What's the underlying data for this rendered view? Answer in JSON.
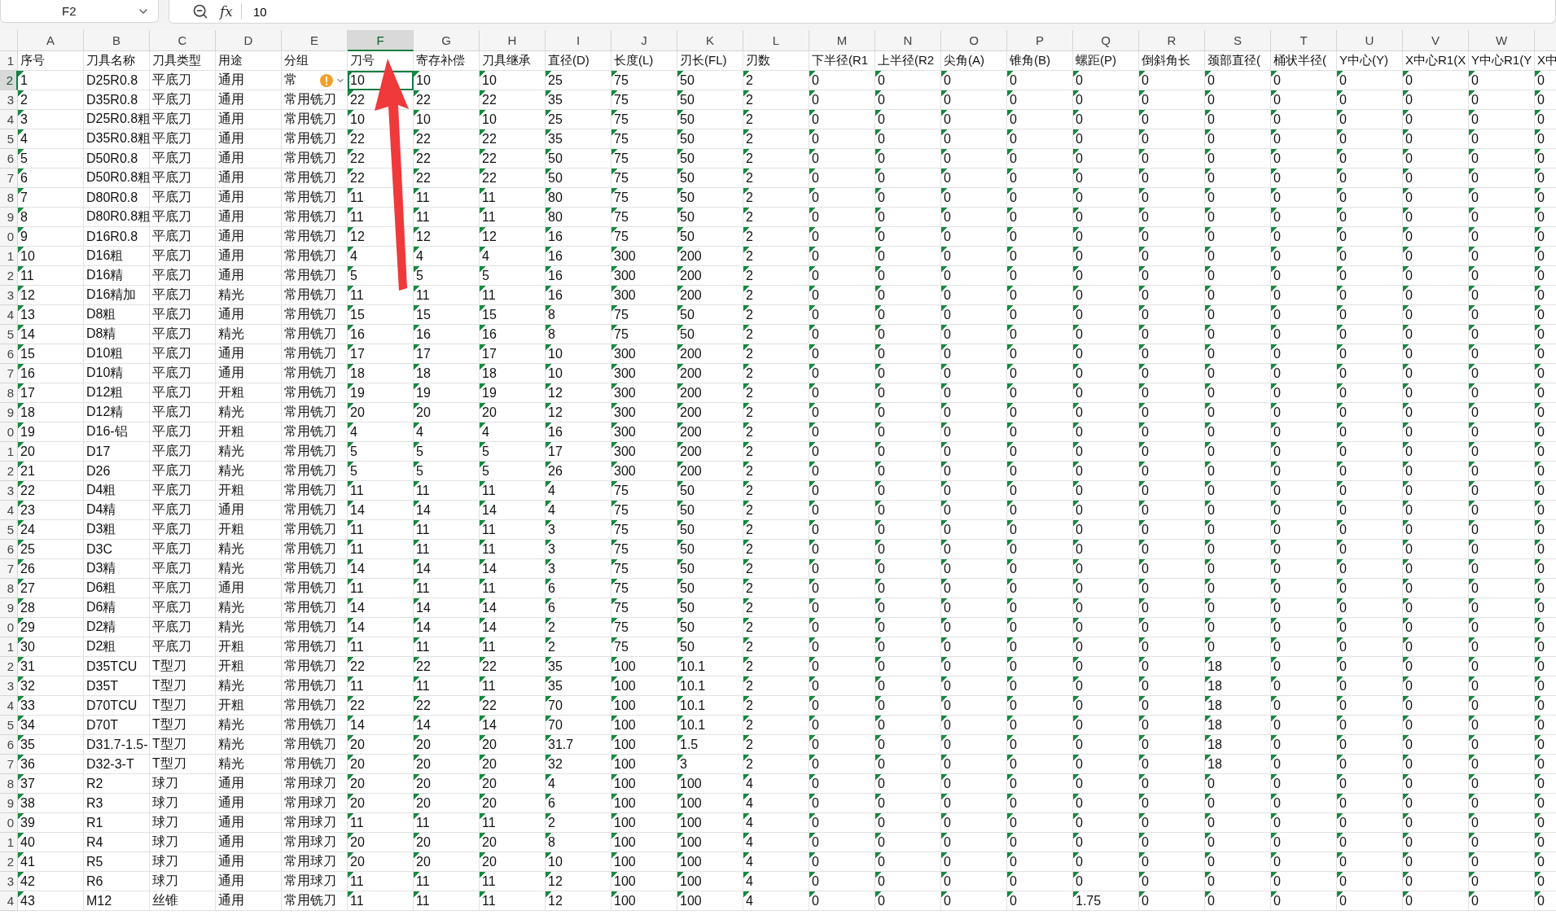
{
  "formula_bar": {
    "name_box": "F2",
    "function_label": "fx",
    "value": "10"
  },
  "columns": [
    {
      "letter": "A",
      "selected": false,
      "flagged": true
    },
    {
      "letter": "B",
      "selected": false,
      "flagged": false
    },
    {
      "letter": "C",
      "selected": false,
      "flagged": false
    },
    {
      "letter": "D",
      "selected": false,
      "flagged": false
    },
    {
      "letter": "E",
      "selected": false,
      "flagged": false
    },
    {
      "letter": "F",
      "selected": true,
      "flagged": true
    },
    {
      "letter": "G",
      "selected": false,
      "flagged": true
    },
    {
      "letter": "H",
      "selected": false,
      "flagged": true
    },
    {
      "letter": "I",
      "selected": false,
      "flagged": true
    },
    {
      "letter": "J",
      "selected": false,
      "flagged": true
    },
    {
      "letter": "K",
      "selected": false,
      "flagged": true
    },
    {
      "letter": "L",
      "selected": false,
      "flagged": true
    },
    {
      "letter": "M",
      "selected": false,
      "flagged": true
    },
    {
      "letter": "N",
      "selected": false,
      "flagged": true
    },
    {
      "letter": "O",
      "selected": false,
      "flagged": true
    },
    {
      "letter": "P",
      "selected": false,
      "flagged": true
    },
    {
      "letter": "Q",
      "selected": false,
      "flagged": true
    },
    {
      "letter": "R",
      "selected": false,
      "flagged": true
    },
    {
      "letter": "S",
      "selected": false,
      "flagged": true
    },
    {
      "letter": "T",
      "selected": false,
      "flagged": true
    },
    {
      "letter": "U",
      "selected": false,
      "flagged": true
    },
    {
      "letter": "V",
      "selected": false,
      "flagged": true
    },
    {
      "letter": "W",
      "selected": false,
      "flagged": true
    },
    {
      "selected": false,
      "flagged": true
    }
  ],
  "rows": [
    {
      "label": "1",
      "kind": "header",
      "selected": false,
      "cells": [
        "序号",
        "刀具名称",
        "刀具类型",
        "用途",
        "分组",
        "刀号",
        "寄存补偿",
        "刀具继承",
        "直径(D)",
        "长度(L)",
        "刃长(FL)",
        "刃数",
        "下半径(R1",
        "上半径(R2",
        "尖角(A)",
        "锥角(B)",
        "螺距(P)",
        "倒斜角长",
        "颈部直径(",
        "桶状半径(",
        "Y中心(Y)",
        "X中心R1(X",
        "Y中心R1(Y",
        "X中"
      ]
    },
    {
      "label": "2",
      "kind": "data",
      "selected": true,
      "warning": true,
      "cells": [
        "1",
        "D25R0.8",
        "平底刀",
        "通用",
        "常",
        "10",
        "10",
        "10",
        "25",
        "75",
        "50",
        "2",
        "0",
        "0",
        "0",
        "0",
        "0",
        "0",
        "0",
        "0",
        "0",
        "0",
        "0",
        "0"
      ]
    },
    {
      "label": "3",
      "kind": "data",
      "selected": false,
      "cells": [
        "2",
        "D35R0.8",
        "平底刀",
        "通用",
        "常用铣刀",
        "22",
        "22",
        "22",
        "35",
        "75",
        "50",
        "2",
        "0",
        "0",
        "0",
        "0",
        "0",
        "0",
        "0",
        "0",
        "0",
        "0",
        "0",
        "0"
      ]
    },
    {
      "label": "4",
      "kind": "data",
      "selected": false,
      "cells": [
        "3",
        "D25R0.8粗",
        "平底刀",
        "通用",
        "常用铣刀",
        "10",
        "10",
        "10",
        "25",
        "75",
        "50",
        "2",
        "0",
        "0",
        "0",
        "0",
        "0",
        "0",
        "0",
        "0",
        "0",
        "0",
        "0",
        "0"
      ]
    },
    {
      "label": "5",
      "kind": "data",
      "selected": false,
      "cells": [
        "4",
        "D35R0.8粗",
        "平底刀",
        "通用",
        "常用铣刀",
        "22",
        "22",
        "22",
        "35",
        "75",
        "50",
        "2",
        "0",
        "0",
        "0",
        "0",
        "0",
        "0",
        "0",
        "0",
        "0",
        "0",
        "0",
        "0"
      ]
    },
    {
      "label": "6",
      "kind": "data",
      "selected": false,
      "cells": [
        "5",
        "D50R0.8",
        "平底刀",
        "通用",
        "常用铣刀",
        "22",
        "22",
        "22",
        "50",
        "75",
        "50",
        "2",
        "0",
        "0",
        "0",
        "0",
        "0",
        "0",
        "0",
        "0",
        "0",
        "0",
        "0",
        "0"
      ]
    },
    {
      "label": "7",
      "kind": "data",
      "selected": false,
      "cells": [
        "6",
        "D50R0.8粗",
        "平底刀",
        "通用",
        "常用铣刀",
        "22",
        "22",
        "22",
        "50",
        "75",
        "50",
        "2",
        "0",
        "0",
        "0",
        "0",
        "0",
        "0",
        "0",
        "0",
        "0",
        "0",
        "0",
        "0"
      ]
    },
    {
      "label": "8",
      "kind": "data",
      "selected": false,
      "cells": [
        "7",
        "D80R0.8",
        "平底刀",
        "通用",
        "常用铣刀",
        "11",
        "11",
        "11",
        "80",
        "75",
        "50",
        "2",
        "0",
        "0",
        "0",
        "0",
        "0",
        "0",
        "0",
        "0",
        "0",
        "0",
        "0",
        "0"
      ]
    },
    {
      "label": "9",
      "kind": "data",
      "selected": false,
      "cells": [
        "8",
        "D80R0.8粗",
        "平底刀",
        "通用",
        "常用铣刀",
        "11",
        "11",
        "11",
        "80",
        "75",
        "50",
        "2",
        "0",
        "0",
        "0",
        "0",
        "0",
        "0",
        "0",
        "0",
        "0",
        "0",
        "0",
        "0"
      ]
    },
    {
      "label": "0",
      "kind": "data",
      "selected": false,
      "cells": [
        "9",
        "D16R0.8",
        "平底刀",
        "通用",
        "常用铣刀",
        "12",
        "12",
        "12",
        "16",
        "75",
        "50",
        "2",
        "0",
        "0",
        "0",
        "0",
        "0",
        "0",
        "0",
        "0",
        "0",
        "0",
        "0",
        "0"
      ]
    },
    {
      "label": "1",
      "kind": "data",
      "selected": false,
      "cells": [
        "10",
        "D16粗",
        "平底刀",
        "通用",
        "常用铣刀",
        "4",
        "4",
        "4",
        "16",
        "300",
        "200",
        "2",
        "0",
        "0",
        "0",
        "0",
        "0",
        "0",
        "0",
        "0",
        "0",
        "0",
        "0",
        "0"
      ]
    },
    {
      "label": "2",
      "kind": "data",
      "selected": false,
      "cells": [
        "11",
        "D16精",
        "平底刀",
        "通用",
        "常用铣刀",
        "5",
        "5",
        "5",
        "16",
        "300",
        "200",
        "2",
        "0",
        "0",
        "0",
        "0",
        "0",
        "0",
        "0",
        "0",
        "0",
        "0",
        "0",
        "0"
      ]
    },
    {
      "label": "3",
      "kind": "data",
      "selected": false,
      "cells": [
        "12",
        "D16精加",
        "平底刀",
        "精光",
        "常用铣刀",
        "11",
        "11",
        "11",
        "16",
        "300",
        "200",
        "2",
        "0",
        "0",
        "0",
        "0",
        "0",
        "0",
        "0",
        "0",
        "0",
        "0",
        "0",
        "0"
      ]
    },
    {
      "label": "4",
      "kind": "data",
      "selected": false,
      "cells": [
        "13",
        "D8粗",
        "平底刀",
        "通用",
        "常用铣刀",
        "15",
        "15",
        "15",
        "8",
        "75",
        "50",
        "2",
        "0",
        "0",
        "0",
        "0",
        "0",
        "0",
        "0",
        "0",
        "0",
        "0",
        "0",
        "0"
      ]
    },
    {
      "label": "5",
      "kind": "data",
      "selected": false,
      "cells": [
        "14",
        "D8精",
        "平底刀",
        "精光",
        "常用铣刀",
        "16",
        "16",
        "16",
        "8",
        "75",
        "50",
        "2",
        "0",
        "0",
        "0",
        "0",
        "0",
        "0",
        "0",
        "0",
        "0",
        "0",
        "0",
        "0"
      ]
    },
    {
      "label": "6",
      "kind": "data",
      "selected": false,
      "cells": [
        "15",
        "D10粗",
        "平底刀",
        "通用",
        "常用铣刀",
        "17",
        "17",
        "17",
        "10",
        "300",
        "200",
        "2",
        "0",
        "0",
        "0",
        "0",
        "0",
        "0",
        "0",
        "0",
        "0",
        "0",
        "0",
        "0"
      ]
    },
    {
      "label": "7",
      "kind": "data",
      "selected": false,
      "cells": [
        "16",
        "D10精",
        "平底刀",
        "通用",
        "常用铣刀",
        "18",
        "18",
        "18",
        "10",
        "300",
        "200",
        "2",
        "0",
        "0",
        "0",
        "0",
        "0",
        "0",
        "0",
        "0",
        "0",
        "0",
        "0",
        "0"
      ]
    },
    {
      "label": "8",
      "kind": "data",
      "selected": false,
      "cells": [
        "17",
        "D12粗",
        "平底刀",
        "开粗",
        "常用铣刀",
        "19",
        "19",
        "19",
        "12",
        "300",
        "200",
        "2",
        "0",
        "0",
        "0",
        "0",
        "0",
        "0",
        "0",
        "0",
        "0",
        "0",
        "0",
        "0"
      ]
    },
    {
      "label": "9",
      "kind": "data",
      "selected": false,
      "cells": [
        "18",
        "D12精",
        "平底刀",
        "精光",
        "常用铣刀",
        "20",
        "20",
        "20",
        "12",
        "300",
        "200",
        "2",
        "0",
        "0",
        "0",
        "0",
        "0",
        "0",
        "0",
        "0",
        "0",
        "0",
        "0",
        "0"
      ]
    },
    {
      "label": "0",
      "kind": "data",
      "selected": false,
      "cells": [
        "19",
        "D16-铝",
        "平底刀",
        "开粗",
        "常用铣刀",
        "4",
        "4",
        "4",
        "16",
        "300",
        "200",
        "2",
        "0",
        "0",
        "0",
        "0",
        "0",
        "0",
        "0",
        "0",
        "0",
        "0",
        "0",
        "0"
      ]
    },
    {
      "label": "1",
      "kind": "data",
      "selected": false,
      "cells": [
        "20",
        "D17",
        "平底刀",
        "精光",
        "常用铣刀",
        "5",
        "5",
        "5",
        "17",
        "300",
        "200",
        "2",
        "0",
        "0",
        "0",
        "0",
        "0",
        "0",
        "0",
        "0",
        "0",
        "0",
        "0",
        "0"
      ]
    },
    {
      "label": "2",
      "kind": "data",
      "selected": false,
      "cells": [
        "21",
        "D26",
        "平底刀",
        "精光",
        "常用铣刀",
        "5",
        "5",
        "5",
        "26",
        "300",
        "200",
        "2",
        "0",
        "0",
        "0",
        "0",
        "0",
        "0",
        "0",
        "0",
        "0",
        "0",
        "0",
        "0"
      ]
    },
    {
      "label": "3",
      "kind": "data",
      "selected": false,
      "cells": [
        "22",
        "D4粗",
        "平底刀",
        "开粗",
        "常用铣刀",
        "11",
        "11",
        "11",
        "4",
        "75",
        "50",
        "2",
        "0",
        "0",
        "0",
        "0",
        "0",
        "0",
        "0",
        "0",
        "0",
        "0",
        "0",
        "0"
      ]
    },
    {
      "label": "4",
      "kind": "data",
      "selected": false,
      "cells": [
        "23",
        "D4精",
        "平底刀",
        "通用",
        "常用铣刀",
        "14",
        "14",
        "14",
        "4",
        "75",
        "50",
        "2",
        "0",
        "0",
        "0",
        "0",
        "0",
        "0",
        "0",
        "0",
        "0",
        "0",
        "0",
        "0"
      ]
    },
    {
      "label": "5",
      "kind": "data",
      "selected": false,
      "cells": [
        "24",
        "D3粗",
        "平底刀",
        "开粗",
        "常用铣刀",
        "11",
        "11",
        "11",
        "3",
        "75",
        "50",
        "2",
        "0",
        "0",
        "0",
        "0",
        "0",
        "0",
        "0",
        "0",
        "0",
        "0",
        "0",
        "0"
      ]
    },
    {
      "label": "6",
      "kind": "data",
      "selected": false,
      "cells": [
        "25",
        "D3C",
        "平底刀",
        "精光",
        "常用铣刀",
        "11",
        "11",
        "11",
        "3",
        "75",
        "50",
        "2",
        "0",
        "0",
        "0",
        "0",
        "0",
        "0",
        "0",
        "0",
        "0",
        "0",
        "0",
        "0"
      ]
    },
    {
      "label": "7",
      "kind": "data",
      "selected": false,
      "cells": [
        "26",
        "D3精",
        "平底刀",
        "精光",
        "常用铣刀",
        "14",
        "14",
        "14",
        "3",
        "75",
        "50",
        "2",
        "0",
        "0",
        "0",
        "0",
        "0",
        "0",
        "0",
        "0",
        "0",
        "0",
        "0",
        "0"
      ]
    },
    {
      "label": "8",
      "kind": "data",
      "selected": false,
      "cells": [
        "27",
        "D6粗",
        "平底刀",
        "通用",
        "常用铣刀",
        "11",
        "11",
        "11",
        "6",
        "75",
        "50",
        "2",
        "0",
        "0",
        "0",
        "0",
        "0",
        "0",
        "0",
        "0",
        "0",
        "0",
        "0",
        "0"
      ]
    },
    {
      "label": "9",
      "kind": "data",
      "selected": false,
      "cells": [
        "28",
        "D6精",
        "平底刀",
        "精光",
        "常用铣刀",
        "14",
        "14",
        "14",
        "6",
        "75",
        "50",
        "2",
        "0",
        "0",
        "0",
        "0",
        "0",
        "0",
        "0",
        "0",
        "0",
        "0",
        "0",
        "0"
      ]
    },
    {
      "label": "0",
      "kind": "data",
      "selected": false,
      "cells": [
        "29",
        "D2精",
        "平底刀",
        "精光",
        "常用铣刀",
        "14",
        "14",
        "14",
        "2",
        "75",
        "50",
        "2",
        "0",
        "0",
        "0",
        "0",
        "0",
        "0",
        "0",
        "0",
        "0",
        "0",
        "0",
        "0"
      ]
    },
    {
      "label": "1",
      "kind": "data",
      "selected": false,
      "cells": [
        "30",
        "D2粗",
        "平底刀",
        "开粗",
        "常用铣刀",
        "11",
        "11",
        "11",
        "2",
        "75",
        "50",
        "2",
        "0",
        "0",
        "0",
        "0",
        "0",
        "0",
        "0",
        "0",
        "0",
        "0",
        "0",
        "0"
      ]
    },
    {
      "label": "2",
      "kind": "data",
      "selected": false,
      "cells": [
        "31",
        "D35TCU",
        "T型刀",
        "开粗",
        "常用铣刀",
        "22",
        "22",
        "22",
        "35",
        "100",
        "10.1",
        "2",
        "0",
        "0",
        "0",
        "0",
        "0",
        "0",
        "18",
        "0",
        "0",
        "0",
        "0",
        "0"
      ]
    },
    {
      "label": "3",
      "kind": "data",
      "selected": false,
      "cells": [
        "32",
        "D35T",
        "T型刀",
        "精光",
        "常用铣刀",
        "11",
        "11",
        "11",
        "35",
        "100",
        "10.1",
        "2",
        "0",
        "0",
        "0",
        "0",
        "0",
        "0",
        "18",
        "0",
        "0",
        "0",
        "0",
        "0"
      ]
    },
    {
      "label": "4",
      "kind": "data",
      "selected": false,
      "cells": [
        "33",
        "D70TCU",
        "T型刀",
        "开粗",
        "常用铣刀",
        "22",
        "22",
        "22",
        "70",
        "100",
        "10.1",
        "2",
        "0",
        "0",
        "0",
        "0",
        "0",
        "0",
        "18",
        "0",
        "0",
        "0",
        "0",
        "0"
      ]
    },
    {
      "label": "5",
      "kind": "data",
      "selected": false,
      "cells": [
        "34",
        "D70T",
        "T型刀",
        "精光",
        "常用铣刀",
        "14",
        "14",
        "14",
        "70",
        "100",
        "10.1",
        "2",
        "0",
        "0",
        "0",
        "0",
        "0",
        "0",
        "18",
        "0",
        "0",
        "0",
        "0",
        "0"
      ]
    },
    {
      "label": "6",
      "kind": "data",
      "selected": false,
      "cells": [
        "35",
        "D31.7-1.5-",
        "T型刀",
        "精光",
        "常用铣刀",
        "20",
        "20",
        "20",
        "31.7",
        "100",
        "1.5",
        "2",
        "0",
        "0",
        "0",
        "0",
        "0",
        "0",
        "18",
        "0",
        "0",
        "0",
        "0",
        "0"
      ]
    },
    {
      "label": "7",
      "kind": "data",
      "selected": false,
      "cells": [
        "36",
        "D32-3-T",
        "T型刀",
        "精光",
        "常用铣刀",
        "20",
        "20",
        "20",
        "32",
        "100",
        "3",
        "2",
        "0",
        "0",
        "0",
        "0",
        "0",
        "0",
        "18",
        "0",
        "0",
        "0",
        "0",
        "0"
      ]
    },
    {
      "label": "8",
      "kind": "data",
      "selected": false,
      "cells": [
        "37",
        "R2",
        "球刀",
        "通用",
        "常用球刀",
        "20",
        "20",
        "20",
        "4",
        "100",
        "100",
        "4",
        "0",
        "0",
        "0",
        "0",
        "0",
        "0",
        "0",
        "0",
        "0",
        "0",
        "0",
        "0"
      ]
    },
    {
      "label": "9",
      "kind": "data",
      "selected": false,
      "cells": [
        "38",
        "R3",
        "球刀",
        "通用",
        "常用球刀",
        "20",
        "20",
        "20",
        "6",
        "100",
        "100",
        "4",
        "0",
        "0",
        "0",
        "0",
        "0",
        "0",
        "0",
        "0",
        "0",
        "0",
        "0",
        "0"
      ]
    },
    {
      "label": "0",
      "kind": "data",
      "selected": false,
      "cells": [
        "39",
        "R1",
        "球刀",
        "通用",
        "常用球刀",
        "11",
        "11",
        "11",
        "2",
        "100",
        "100",
        "4",
        "0",
        "0",
        "0",
        "0",
        "0",
        "0",
        "0",
        "0",
        "0",
        "0",
        "0",
        "0"
      ]
    },
    {
      "label": "1",
      "kind": "data",
      "selected": false,
      "cells": [
        "40",
        "R4",
        "球刀",
        "通用",
        "常用球刀",
        "20",
        "20",
        "20",
        "8",
        "100",
        "100",
        "4",
        "0",
        "0",
        "0",
        "0",
        "0",
        "0",
        "0",
        "0",
        "0",
        "0",
        "0",
        "0"
      ]
    },
    {
      "label": "2",
      "kind": "data",
      "selected": false,
      "cells": [
        "41",
        "R5",
        "球刀",
        "通用",
        "常用球刀",
        "20",
        "20",
        "20",
        "10",
        "100",
        "100",
        "4",
        "0",
        "0",
        "0",
        "0",
        "0",
        "0",
        "0",
        "0",
        "0",
        "0",
        "0",
        "0"
      ]
    },
    {
      "label": "3",
      "kind": "data",
      "selected": false,
      "cells": [
        "42",
        "R6",
        "球刀",
        "通用",
        "常用球刀",
        "11",
        "11",
        "11",
        "12",
        "100",
        "100",
        "4",
        "0",
        "0",
        "0",
        "0",
        "0",
        "0",
        "0",
        "0",
        "0",
        "0",
        "0",
        "0"
      ]
    },
    {
      "label": "4",
      "kind": "data",
      "selected": false,
      "cells": [
        "43",
        "M12",
        "丝锥",
        "通用",
        "常用铣刀",
        "11",
        "11",
        "11",
        "12",
        "100",
        "100",
        "4",
        "0",
        "0",
        "0",
        "0",
        "1.75",
        "0",
        "0",
        "0",
        "0",
        "0",
        "0",
        "0"
      ]
    }
  ]
}
